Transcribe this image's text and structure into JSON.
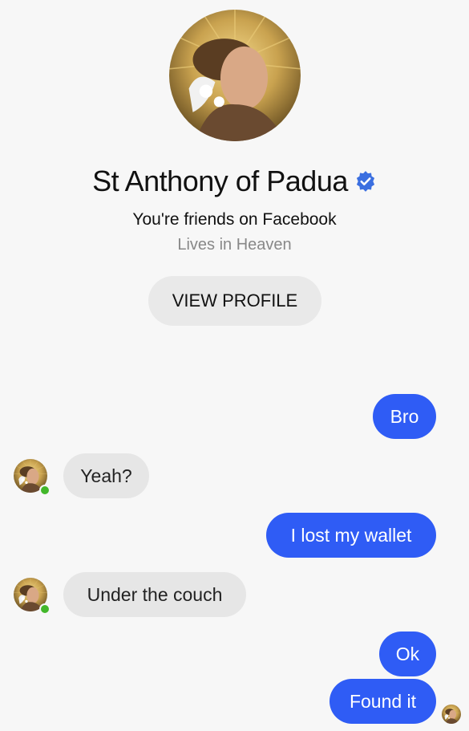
{
  "profile": {
    "name": "St Anthony of Padua",
    "verified": true,
    "friends_text": "You're friends on Facebook",
    "lives_text": "Lives in Heaven",
    "view_profile_label": "VIEW PROFILE"
  },
  "messages": [
    {
      "direction": "outgoing",
      "text": "Bro"
    },
    {
      "direction": "incoming",
      "text": "Yeah?"
    },
    {
      "direction": "outgoing",
      "text": "I lost my wallet"
    },
    {
      "direction": "incoming",
      "text": "Under the couch"
    },
    {
      "direction": "outgoing",
      "text": "Ok"
    },
    {
      "direction": "outgoing",
      "text": "Found it"
    }
  ],
  "colors": {
    "outgoing_bubble": "#2f5cf5",
    "incoming_bubble": "#e6e6e6",
    "verified_badge": "#3b6fe0",
    "online_dot": "#42b72a"
  }
}
